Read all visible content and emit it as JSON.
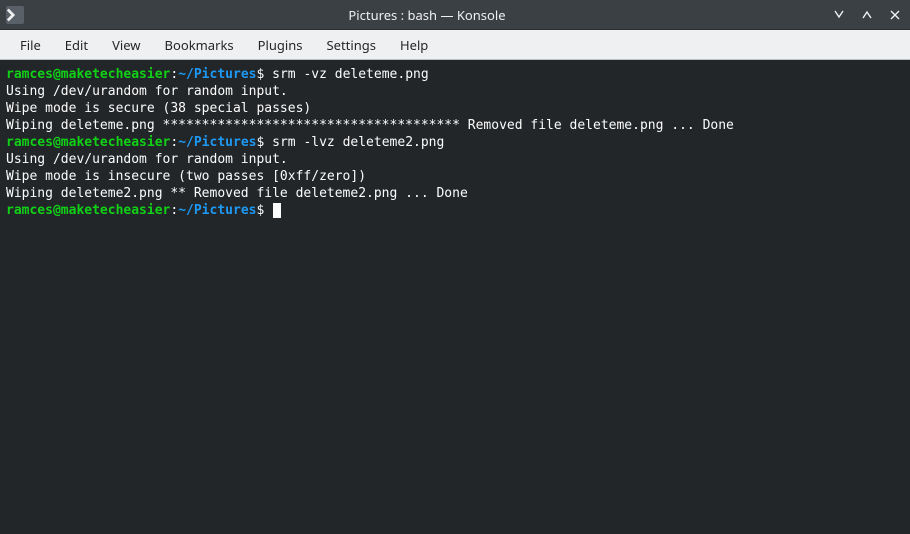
{
  "window": {
    "title": "Pictures : bash — Konsole"
  },
  "menubar": {
    "items": [
      "File",
      "Edit",
      "View",
      "Bookmarks",
      "Plugins",
      "Settings",
      "Help"
    ]
  },
  "terminal": {
    "prompt_user_host": "ramces@maketecheasier",
    "prompt_sep": ":",
    "prompt_path": "~/Pictures",
    "prompt_symbol": "$",
    "lines": [
      {
        "type": "prompt",
        "command": "srm -vz deleteme.png"
      },
      {
        "type": "output",
        "text": "Using /dev/urandom for random input."
      },
      {
        "type": "output",
        "text": "Wipe mode is secure (38 special passes)"
      },
      {
        "type": "output",
        "text": "Wiping deleteme.png ************************************** Removed file deleteme.png ... Done"
      },
      {
        "type": "prompt",
        "command": "srm -lvz deleteme2.png"
      },
      {
        "type": "output",
        "text": "Using /dev/urandom for random input."
      },
      {
        "type": "output",
        "text": "Wipe mode is insecure (two passes [0xff/zero])"
      },
      {
        "type": "output",
        "text": "Wiping deleteme2.png ** Removed file deleteme2.png ... Done"
      },
      {
        "type": "prompt",
        "command": "",
        "cursor": true
      }
    ]
  }
}
